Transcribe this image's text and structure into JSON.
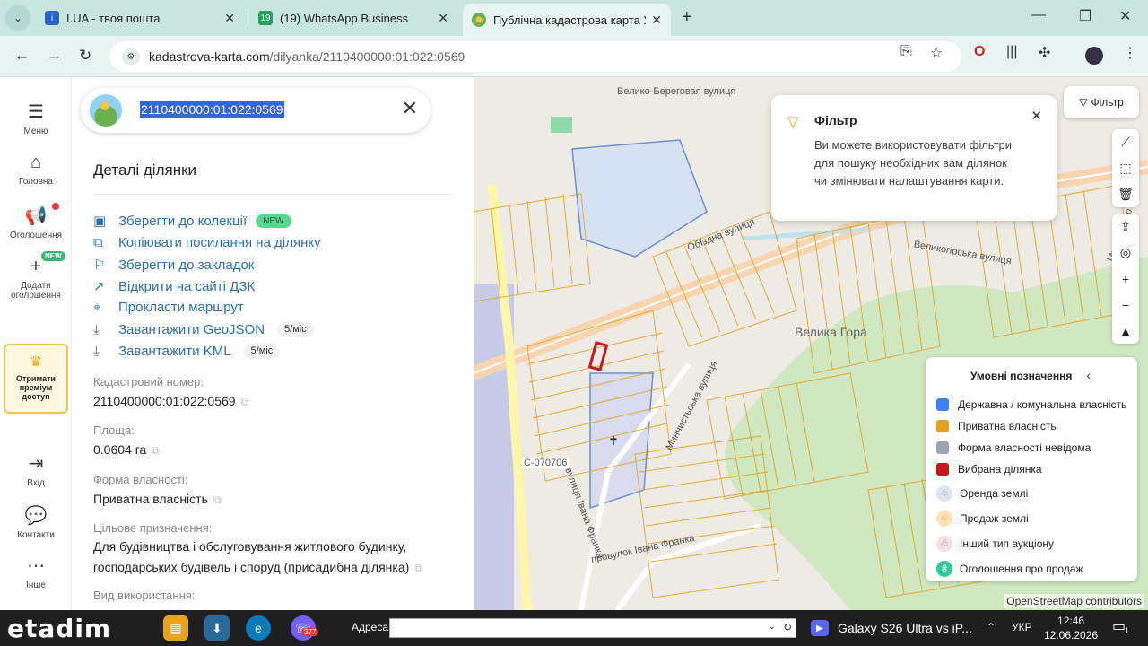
{
  "browser": {
    "tabs": [
      {
        "title": "I.UA - твоя пошта",
        "icon": "iua-icon"
      },
      {
        "title": "(19) WhatsApp Business",
        "icon": "whatsapp-icon",
        "badge": "19"
      },
      {
        "title": "Публічна кадастрова карта Ук",
        "icon": "kadastr-icon"
      }
    ],
    "url_domain": "kadastrova-karta.com",
    "url_path": "/dilyanka/2110400000:01:022:0569"
  },
  "rail": {
    "menu": "Меню",
    "home": "Головна",
    "ads": "Оголошення",
    "add_ads": "Додати оголошення",
    "new_badge": "NEW",
    "premium": "Отримати преміум доступ",
    "login": "Вхід",
    "contacts": "Контакти",
    "other": "Інше"
  },
  "search": {
    "query": "2110400000:01:022:0569"
  },
  "panel": {
    "title": "Деталі ділянки",
    "actions": {
      "save_collection": "Зберегти до колекції",
      "new_badge": "NEW",
      "copy_link": "Копіювати посилання на ділянку",
      "bookmark": "Зберегти до закладок",
      "open_dzk": "Відкрити на сайті ДЗК",
      "route": "Прокласти маршрут",
      "geojson": "Завантажити GeoJSON",
      "geojson_limit": "5/міс",
      "kml": "Завантажити KML",
      "kml_limit": "5/міс"
    },
    "fields": {
      "cad_label": "Кадастровий номер:",
      "cad_value": "2110400000:01:022:0569",
      "area_label": "Площа:",
      "area_value": "0.0604 га",
      "ownership_label": "Форма власності:",
      "ownership_value": "Приватна власність",
      "purpose_label": "Цільове призначення:",
      "purpose_value": "Для будівництва і обслуговування житлового будинку, господарських будівель і споруд (присадибна ділянка)",
      "usage_label": "Вид використання:"
    }
  },
  "map": {
    "filter_btn": "Фільтр",
    "popup_title": "Фільтр",
    "popup_body": "Ви можете використовувати фільтри для пошуку необхідних вам ділянок чи змінювати налаштування карти.",
    "labels": {
      "street1": "Велико-Береговая вулиця",
      "street2": "Обїздна вулиця",
      "street3": "Великогірська вулиця",
      "street4": "Минчистьська вулиця",
      "street5": "провулок Івана Франка",
      "street6": "вулиця Івана Франка",
      "road": "С-070706",
      "village": "Велика Гора",
      "street7": "Мукачівсько"
    },
    "attribution": "OpenStreetMap contributors",
    "legend": {
      "title": "Умовні позначення",
      "items": [
        {
          "label": "Державна / комунальна власність",
          "color": "#3b82f6"
        },
        {
          "label": "Приватна власність",
          "color": "#e5a11c"
        },
        {
          "label": "Форма власності невідома",
          "color": "#9aa4b2"
        },
        {
          "label": "Вибрана ділянка",
          "color": "#c51919"
        }
      ],
      "auctions": [
        {
          "label": "Оренда землі",
          "icon": "rent-icon"
        },
        {
          "label": "Продаж землі",
          "icon": "sale-icon"
        },
        {
          "label": "Інший тип аукціону",
          "icon": "auction-icon"
        },
        {
          "label": "Оголошення про продаж",
          "icon": "hryvnia-icon"
        }
      ]
    }
  },
  "taskbar": {
    "logo": "etadim",
    "addr_label": "Адреса",
    "media": "Galaxy S26 Ultra vs iP...",
    "lang": "УКР",
    "time": "12:46",
    "date": "12.06.2026",
    "viber_badge": "377",
    "notif": "1"
  }
}
